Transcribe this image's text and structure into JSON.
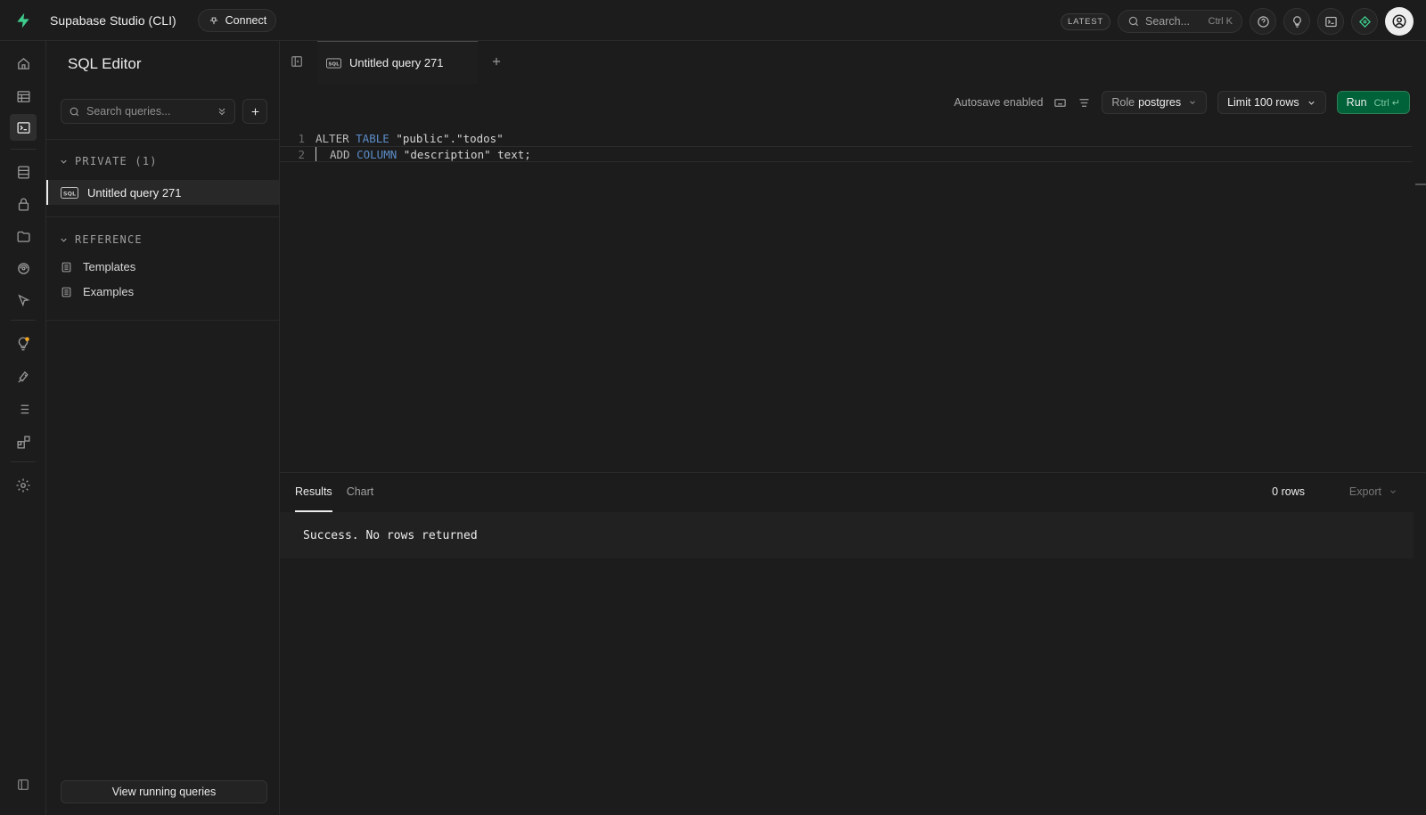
{
  "app": {
    "title": "Supabase Studio (CLI)",
    "connect_label": "Connect",
    "badge": "LATEST",
    "search_placeholder": "Search...",
    "search_shortcut": "Ctrl K"
  },
  "sidebar": {
    "title": "SQL Editor",
    "search_placeholder": "Search queries...",
    "private_header": "PRIVATE (1)",
    "private_items": [
      {
        "badge": "SQL",
        "label": "Untitled query 271"
      }
    ],
    "reference_header": "REFERENCE",
    "reference_items": [
      {
        "label": "Templates"
      },
      {
        "label": "Examples"
      }
    ],
    "bottom_button": "View running queries"
  },
  "tabs": [
    {
      "label": "Untitled query 271",
      "badge": "SQL"
    }
  ],
  "toolbar": {
    "autosave": "Autosave enabled",
    "role_prefix": "Role",
    "role_value": "postgres",
    "limit_label": "Limit 100 rows",
    "run_label": "Run",
    "run_shortcut": "Ctrl ↵"
  },
  "editor": {
    "lines": [
      {
        "num": "1",
        "t1": "ALTER ",
        "t2": "TABLE",
        "t3": " \"public\".\"todos\""
      },
      {
        "num": "2",
        "t1": "ADD ",
        "t2": "COLUMN",
        "t3": " \"description\" text;"
      }
    ]
  },
  "results": {
    "tabs": [
      "Results",
      "Chart"
    ],
    "rows": "0 rows",
    "export_label": "Export",
    "message": "Success. No rows returned"
  },
  "colors": {
    "brand": "#3ecf8e",
    "run_button": "#006239",
    "background": "#1c1c1c",
    "keyword_blue": "#5b8cc8"
  },
  "icons": {
    "rail": [
      "home-icon",
      "table-editor-icon",
      "sql-editor-icon",
      "database-icon",
      "auth-lock-icon",
      "storage-icon",
      "realtime-icon",
      "edge-functions-icon",
      "advisors-icon",
      "reports-icon",
      "logs-icon",
      "integrations-icon",
      "settings-icon",
      "collapse-sidebar-icon"
    ]
  }
}
